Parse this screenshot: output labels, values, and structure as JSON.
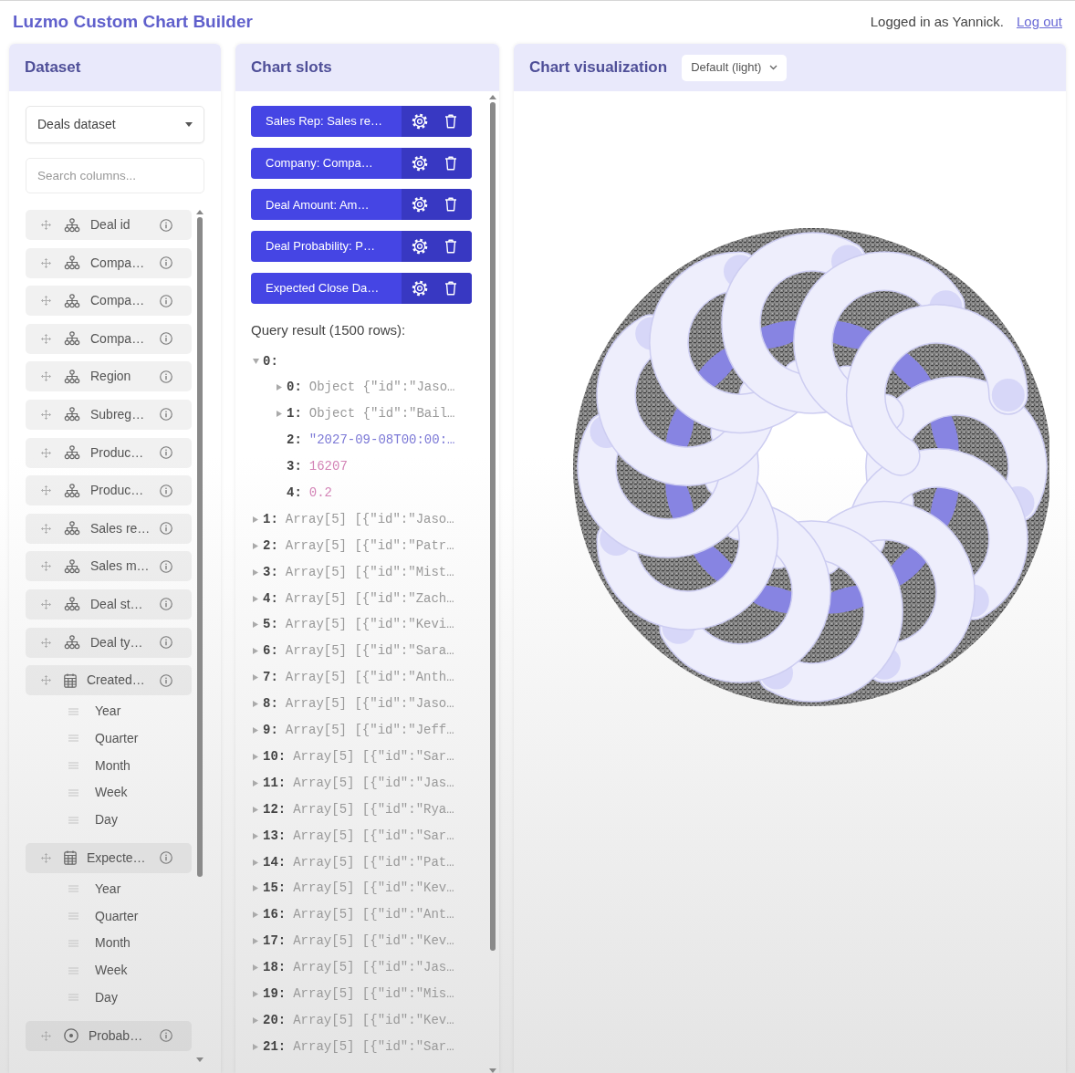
{
  "header": {
    "title": "Luzmo Custom Chart Builder",
    "user_text": "Logged in as Yannick.",
    "logout_link": "Log out"
  },
  "dataset_panel": {
    "title": "Dataset",
    "dataset_select": {
      "value": "Deals dataset"
    },
    "search": {
      "placeholder": "Search columns..."
    },
    "columns": [
      {
        "label": "Deal id",
        "kind": "hierarchy"
      },
      {
        "label": "Compa…",
        "kind": "hierarchy"
      },
      {
        "label": "Compa…",
        "kind": "hierarchy"
      },
      {
        "label": "Compa…",
        "kind": "hierarchy"
      },
      {
        "label": "Region",
        "kind": "hierarchy"
      },
      {
        "label": "Subreg…",
        "kind": "hierarchy"
      },
      {
        "label": "Produc…",
        "kind": "hierarchy"
      },
      {
        "label": "Produc…",
        "kind": "hierarchy"
      },
      {
        "label": "Sales re…",
        "kind": "hierarchy"
      },
      {
        "label": "Sales m…",
        "kind": "hierarchy"
      },
      {
        "label": "Deal st…",
        "kind": "hierarchy"
      },
      {
        "label": "Deal ty…",
        "kind": "hierarchy"
      },
      {
        "label": "Created…",
        "kind": "datetime",
        "children": [
          {
            "label": "Year"
          },
          {
            "label": "Quarter"
          },
          {
            "label": "Month"
          },
          {
            "label": "Week"
          },
          {
            "label": "Day"
          }
        ]
      },
      {
        "label": "Expecte…",
        "kind": "datetime",
        "children": [
          {
            "label": "Year"
          },
          {
            "label": "Quarter"
          },
          {
            "label": "Month"
          },
          {
            "label": "Week"
          },
          {
            "label": "Day"
          }
        ]
      },
      {
        "label": "Probab…",
        "kind": "numeric"
      }
    ]
  },
  "slots_panel": {
    "title": "Chart slots",
    "slots": [
      {
        "label": "Sales Rep: Sales re…"
      },
      {
        "label": "Company: Compa…"
      },
      {
        "label": "Deal Amount: Am…"
      },
      {
        "label": "Deal Probability: P…"
      },
      {
        "label": "Expected Close Da…"
      }
    ],
    "query_result": {
      "title": "Query result (1500 rows):",
      "rows": [
        {
          "key": "0:",
          "expanded": true,
          "children": [
            {
              "key": "0:",
              "expanded": false,
              "kind": "object",
              "value": "Object {\"id\":\"Jaso…"
            },
            {
              "key": "1:",
              "expanded": false,
              "kind": "object",
              "value": "Object {\"id\":\"Bail…"
            },
            {
              "key": "2:",
              "kind": "string",
              "value": "\"2027-09-08T00:00:…"
            },
            {
              "key": "3:",
              "kind": "number",
              "value": "16207"
            },
            {
              "key": "4:",
              "kind": "number",
              "value": "0.2"
            }
          ]
        },
        {
          "key": "1:",
          "expanded": false,
          "value": "Array[5] [{\"id\":\"Jaso…"
        },
        {
          "key": "2:",
          "expanded": false,
          "value": "Array[5] [{\"id\":\"Patr…"
        },
        {
          "key": "3:",
          "expanded": false,
          "value": "Array[5] [{\"id\":\"Mist…"
        },
        {
          "key": "4:",
          "expanded": false,
          "value": "Array[5] [{\"id\":\"Zach…"
        },
        {
          "key": "5:",
          "expanded": false,
          "value": "Array[5] [{\"id\":\"Kevi…"
        },
        {
          "key": "6:",
          "expanded": false,
          "value": "Array[5] [{\"id\":\"Sara…"
        },
        {
          "key": "7:",
          "expanded": false,
          "value": "Array[5] [{\"id\":\"Anth…"
        },
        {
          "key": "8:",
          "expanded": false,
          "value": "Array[5] [{\"id\":\"Jaso…"
        },
        {
          "key": "9:",
          "expanded": false,
          "value": "Array[5] [{\"id\":\"Jeff…"
        },
        {
          "key": "10:",
          "expanded": false,
          "value": "Array[5] [{\"id\":\"Sar…"
        },
        {
          "key": "11:",
          "expanded": false,
          "value": "Array[5] [{\"id\":\"Jas…"
        },
        {
          "key": "12:",
          "expanded": false,
          "value": "Array[5] [{\"id\":\"Rya…"
        },
        {
          "key": "13:",
          "expanded": false,
          "value": "Array[5] [{\"id\":\"Sar…"
        },
        {
          "key": "14:",
          "expanded": false,
          "value": "Array[5] [{\"id\":\"Pat…"
        },
        {
          "key": "15:",
          "expanded": false,
          "value": "Array[5] [{\"id\":\"Kev…"
        },
        {
          "key": "16:",
          "expanded": false,
          "value": "Array[5] [{\"id\":\"Ant…"
        },
        {
          "key": "17:",
          "expanded": false,
          "value": "Array[5] [{\"id\":\"Kev…"
        },
        {
          "key": "18:",
          "expanded": false,
          "value": "Array[5] [{\"id\":\"Jas…"
        },
        {
          "key": "19:",
          "expanded": false,
          "value": "Array[5] [{\"id\":\"Mis…"
        },
        {
          "key": "20:",
          "expanded": false,
          "value": "Array[5] [{\"id\":\"Kev…"
        },
        {
          "key": "21:",
          "expanded": false,
          "value": "Array[5] [{\"id\":\"Sar…"
        }
      ]
    }
  },
  "chart_panel": {
    "title": "Chart visualization",
    "theme_select": {
      "value": "Default (light)"
    }
  }
}
